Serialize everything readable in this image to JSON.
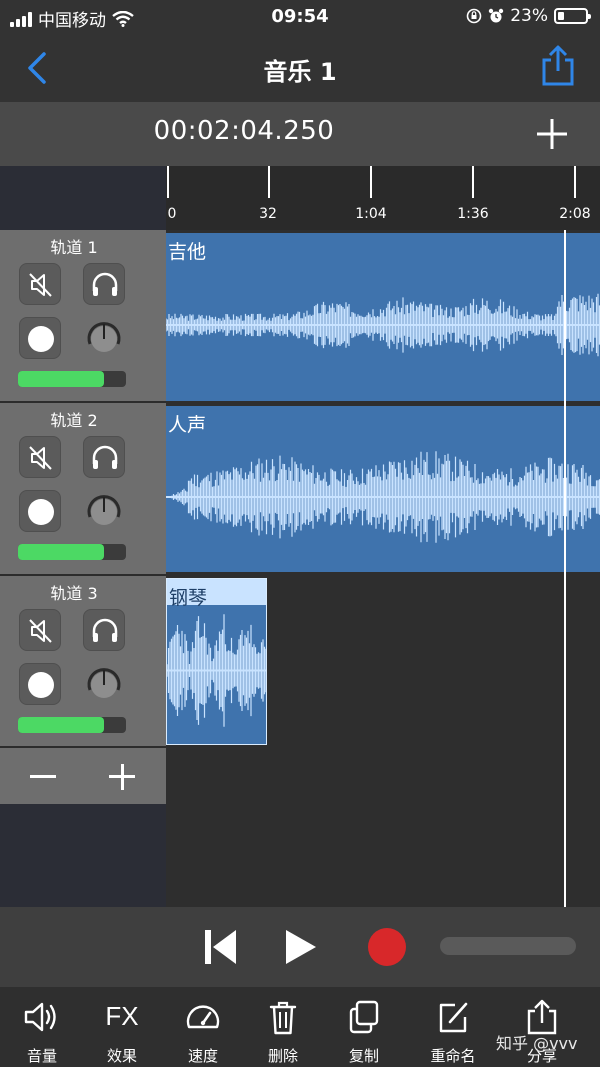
{
  "status_bar": {
    "carrier": "中国移动",
    "time": "09:54",
    "battery": "23%",
    "battery_level": 0.23
  },
  "nav": {
    "title": "音乐 1"
  },
  "timecode": "00:02:04.250",
  "ruler": {
    "ticks": [
      "0",
      "32",
      "1:04",
      "1:36",
      "2:08"
    ]
  },
  "tracks": [
    {
      "name": "轨道 1",
      "clip_label": "吉他",
      "volume_level": 0.8
    },
    {
      "name": "轨道 2",
      "clip_label": "人声",
      "volume_level": 0.8
    },
    {
      "name": "轨道 3",
      "clip_label": "钢琴",
      "volume_level": 0.8
    }
  ],
  "toolbar": {
    "volume": "音量",
    "fx_glyph": "FX",
    "effects": "效果",
    "speed": "速度",
    "delete": "删除",
    "copy": "复制",
    "rename": "重命名",
    "share": "分享"
  },
  "watermark": "知乎 @vvv",
  "colors": {
    "accent_blue": "#2f86e8",
    "clip_blue": "#3f73ad",
    "wave": "#c9e3ff",
    "volume_green": "#4cd964",
    "record_red": "#d8282a"
  },
  "icons": {
    "back": "chevron-left-icon",
    "share": "share-icon",
    "add": "plus-icon",
    "mute": "speaker-muted-icon",
    "solo": "headphones-icon",
    "record": "record-icon",
    "pan": "knob-icon",
    "skip_back": "skip-back-icon",
    "play": "play-icon",
    "trash": "trash-icon"
  }
}
